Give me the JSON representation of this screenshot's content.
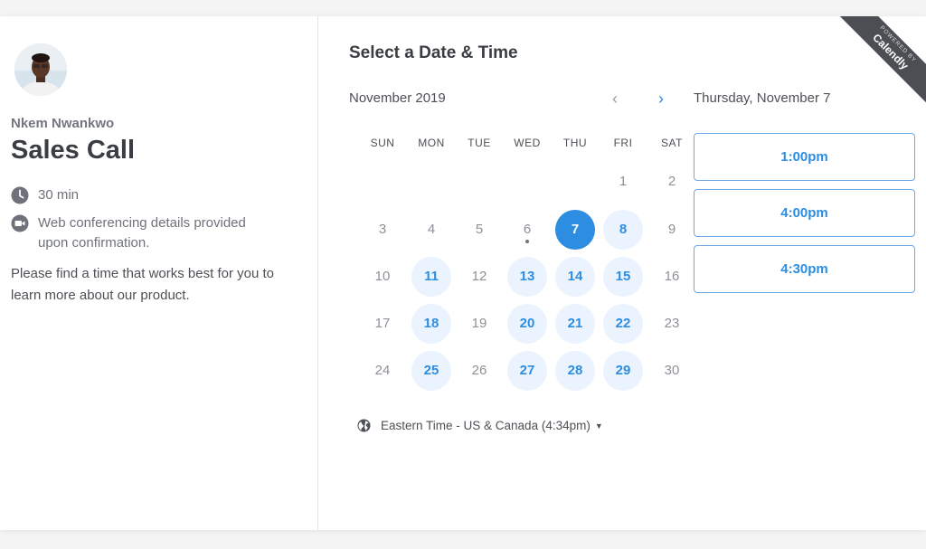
{
  "event": {
    "host_name": "Nkem Nwankwo",
    "title": "Sales Call",
    "duration": "30 min",
    "location_line1": "Web conferencing details provided",
    "location_line2": "upon confirmation.",
    "description": "Please find a time that works best for you to learn more about our product."
  },
  "calendar": {
    "heading": "Select a Date & Time",
    "month_label": "November 2019",
    "weekdays": [
      "SUN",
      "MON",
      "TUE",
      "WED",
      "THU",
      "FRI",
      "SAT"
    ],
    "weeks": [
      [
        "",
        "",
        "",
        "",
        "",
        "1",
        "2"
      ],
      [
        "3",
        "4",
        "5",
        "6",
        "7",
        "8",
        "9"
      ],
      [
        "10",
        "11",
        "12",
        "13",
        "14",
        "15",
        "16"
      ],
      [
        "17",
        "18",
        "19",
        "20",
        "21",
        "22",
        "23"
      ],
      [
        "24",
        "25",
        "26",
        "27",
        "28",
        "29",
        "30"
      ]
    ],
    "available_days": [
      "7",
      "8",
      "11",
      "13",
      "14",
      "15",
      "18",
      "20",
      "21",
      "22",
      "25",
      "27",
      "28",
      "29"
    ],
    "selected_day": "7",
    "today_marker_day": "6",
    "timezone": "Eastern Time - US & Canada (4:34pm)"
  },
  "times": {
    "selected_date_label": "Thursday, November 7",
    "slots": [
      "1:00pm",
      "4:00pm",
      "4:30pm"
    ]
  },
  "ribbon": {
    "small": "POWERED BY",
    "brand": "Calendly"
  },
  "colors": {
    "accent": "#2d8de0",
    "available_bg": "#eaf3fe",
    "ribbon": "#4b4e52"
  }
}
